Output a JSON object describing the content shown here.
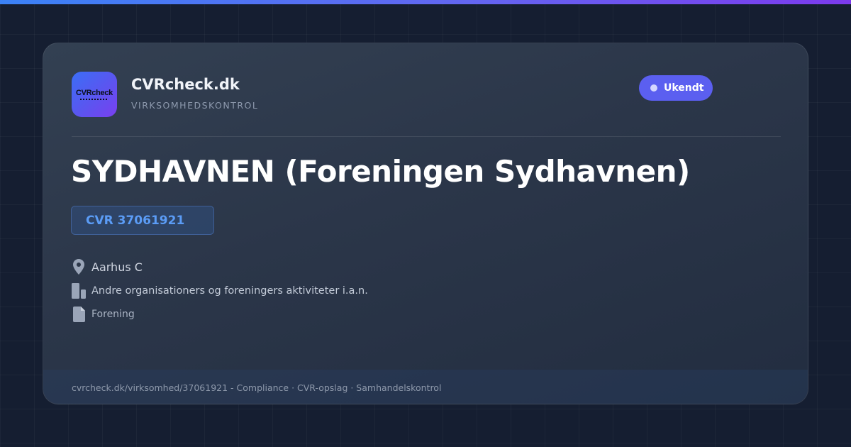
{
  "brand": {
    "logo_text": "CVRcheck",
    "name": "CVRcheck.dk",
    "tagline": "VIRKSOMHEDSKONTROL"
  },
  "status": {
    "label": "Ukendt",
    "color": "#5b5ff0"
  },
  "company": {
    "name": "SYDHAVNEN (Foreningen Sydhavnen)",
    "cvr": "CVR 37061921",
    "city": "Aarhus C",
    "industry": "Andre organisationers og foreningers aktiviteter i.a.n.",
    "type": "Forening"
  },
  "icons": {
    "city": "location-pin-icon",
    "industry": "building-icon",
    "type": "document-icon"
  },
  "footer": {
    "text": "cvrcheck.dk/virksomhed/37061921 - Compliance · CVR-opslag · Samhandelskontrol"
  },
  "colors": {
    "accent_blue": "#3b82f6",
    "accent_purple": "#7c3aed",
    "cvr_text": "#5b9cf6"
  }
}
